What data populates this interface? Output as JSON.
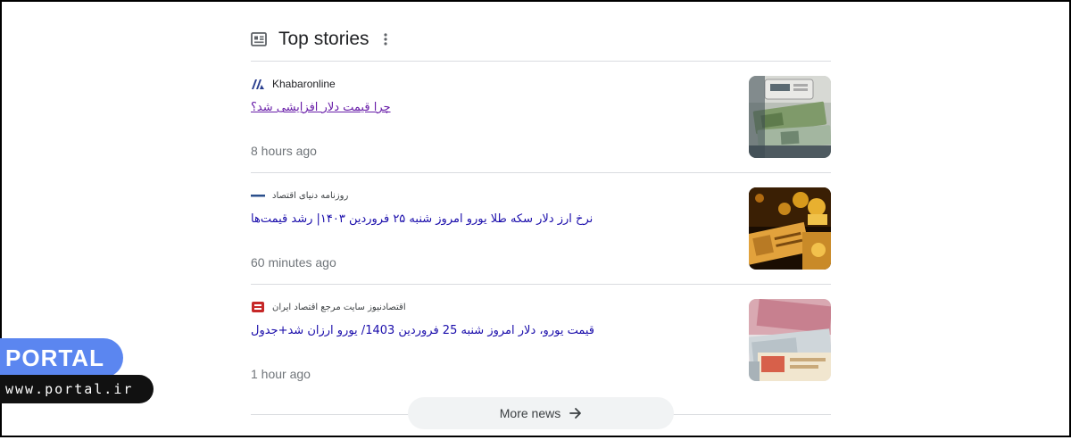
{
  "module": {
    "title": "Top stories",
    "icons": {
      "section": "news-icon",
      "more": "more-vert-icon"
    }
  },
  "stories": [
    {
      "source": "Khabaronline",
      "headline": "چرا قیمت دلار افزایشی شد؟",
      "time": "8 hours ago",
      "thumbnail": "money-counter-image"
    },
    {
      "source": "روزنامه دنیای اقتصاد",
      "headline": "نرخ ارز دلار سکه طلا یورو امروز شنبه ۲۵ فروردین ۱۴۰۳| رشد قیمت‌ها",
      "time": "60 minutes ago",
      "thumbnail": "gold-coins-image"
    },
    {
      "source": "اقتصادنیوز سایت مرجع اقتصاد ایران",
      "headline": "قیمت یورو، دلار امروز شنبه 25 فروردین 1403/ یورو ارزان شد+جدول",
      "time": "1 hour ago",
      "thumbnail": "euro-banknotes-image"
    }
  ],
  "more_news": {
    "label": "More news",
    "icon": "arrow-right-icon"
  },
  "watermark": {
    "brand": "PORTAL",
    "url": "www.portal.ir"
  },
  "colors": {
    "link_blue": "#1a0dab",
    "link_visited": "#681da8",
    "meta_gray": "#70757a",
    "badge_blue": "#5b86f0"
  }
}
